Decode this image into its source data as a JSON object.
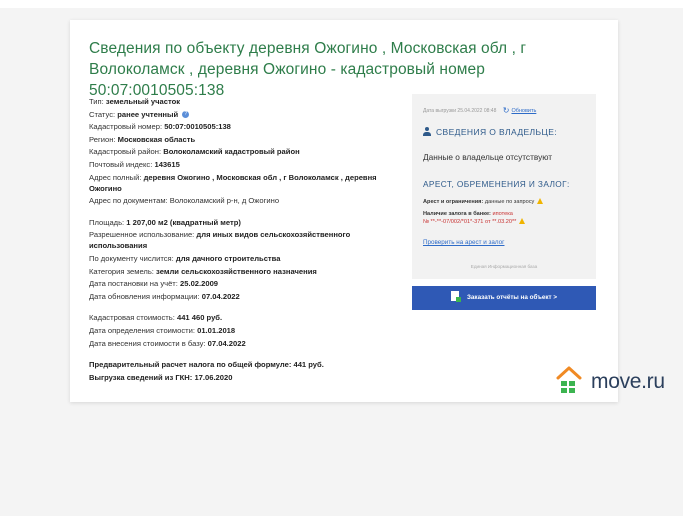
{
  "title": "Сведения по объекту деревня Ожогино , Московская обл , г Волоколамск , деревня Ожогино - кадастровый номер 50:07:0010505:138",
  "object_info": {
    "group1": [
      {
        "label": "Тип:",
        "value": "земельный участок"
      },
      {
        "label": "Статус:",
        "value": "ранее учтенный"
      },
      {
        "label": "Кадастровый номер:",
        "value": "50:07:0010505:138"
      },
      {
        "label": "Регион:",
        "value": "Московская область"
      },
      {
        "label": "Кадастровый район:",
        "value": "Волоколамский кадастровый район"
      },
      {
        "label": "Почтовый индекс:",
        "value": "143615"
      },
      {
        "label": "Адрес полный:",
        "value": "деревня Ожогино , Московская обл , г Волоколамск , деревня Ожогино"
      },
      {
        "label": "Адрес по документам:",
        "value": "Волоколамский р-н, д Ожогино"
      }
    ],
    "group2": [
      {
        "label": "Площадь:",
        "value": "1 207,00 м2 (квадратный метр)"
      },
      {
        "label": "Разрешенное использование:",
        "value": "для иных видов сельскохозяйственного использования"
      },
      {
        "label": "По документу числится:",
        "value": "для дачного строительства"
      },
      {
        "label": "Категория земель:",
        "value": "земли сельскохозяйственного назначения"
      },
      {
        "label": "Дата постановки на учёт:",
        "value": "25.02.2009"
      },
      {
        "label": "Дата обновления информации:",
        "value": "07.04.2022"
      }
    ],
    "group3": [
      {
        "label": "Кадастровая стоимость:",
        "value": "441 460 руб."
      },
      {
        "label": "Дата определения стоимости:",
        "value": "01.01.2018"
      },
      {
        "label": "Дата внесения стоимости в базу:",
        "value": "07.04.2022"
      }
    ],
    "group4": [
      {
        "label": "Предварительный расчет налога по общей формуле:",
        "value": "441 руб."
      },
      {
        "label": "Выгрузка сведений из ГКН:",
        "value": "17.06.2020"
      }
    ]
  },
  "panel": {
    "export_date": "Дата выгрузки 25.04.2022 08:48",
    "refresh_label": "Обновить",
    "owner_heading": "СВЕДЕНИЯ О ВЛАДЕЛЬЦЕ:",
    "owner_text": "Данные о владельце отсутствуют",
    "arrest_heading": "АРЕСТ, ОБРЕМЕНЕНИЯ И ЗАЛОГ:",
    "arrest_label": "Арест и ограничения:",
    "arrest_value": "данные по запросу",
    "bank_label": "Наличие залога в банке:",
    "bank_value": "ипотека",
    "bank_number": "№ **-**-07/002/*01*-371 от **.03.20**",
    "check_link": "Проверить на арест и залог",
    "base_label": "Единая Информационная база"
  },
  "order_button": "Заказать отчёты на объект >",
  "logo_text": "move.ru",
  "colors": {
    "title_green": "#2e7d4a",
    "heading_blue": "#2e5a8a",
    "link_blue": "#2d6bc8",
    "button_blue": "#2f59b5",
    "warning": "#f0b400",
    "logo_orange": "#f08a24",
    "logo_green": "#3cb450"
  }
}
